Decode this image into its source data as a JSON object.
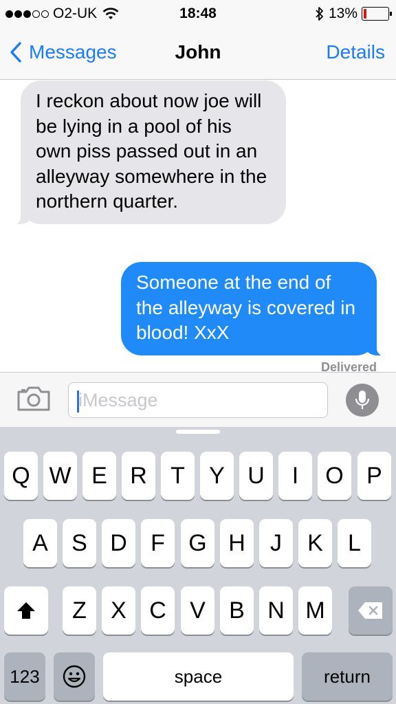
{
  "status_bar": {
    "carrier": "O2-UK",
    "time": "18:48",
    "battery_percent": "13%",
    "battery_level": 0.13,
    "battery_color": "#e0140f",
    "signal_bars_filled": 3,
    "signal_bars_total": 5
  },
  "nav": {
    "back_label": "Messages",
    "title": "John",
    "details_label": "Details",
    "accent_color": "#1a7cf5"
  },
  "conversation": {
    "messages": [
      {
        "direction": "incoming",
        "text": "I reckon about now joe will be lying in a pool of his own piss passed out in an alleyway somewhere in the northern quarter."
      },
      {
        "direction": "outgoing",
        "text": "Someone at the end of the alleyway is covered in blood! XxX"
      }
    ],
    "delivered_label": "Delivered"
  },
  "input_bar": {
    "placeholder": "iMessage",
    "value": ""
  },
  "keyboard": {
    "row1": [
      "Q",
      "W",
      "E",
      "R",
      "T",
      "Y",
      "U",
      "I",
      "O",
      "P"
    ],
    "row2": [
      "A",
      "S",
      "D",
      "F",
      "G",
      "H",
      "J",
      "K",
      "L"
    ],
    "row3": [
      "Z",
      "X",
      "C",
      "V",
      "B",
      "N",
      "M"
    ],
    "numbers_label": "123",
    "space_label": "space",
    "return_label": "return",
    "icons": {
      "shift": "shift-icon",
      "delete": "delete-icon",
      "emoji": "emoji-icon"
    }
  }
}
